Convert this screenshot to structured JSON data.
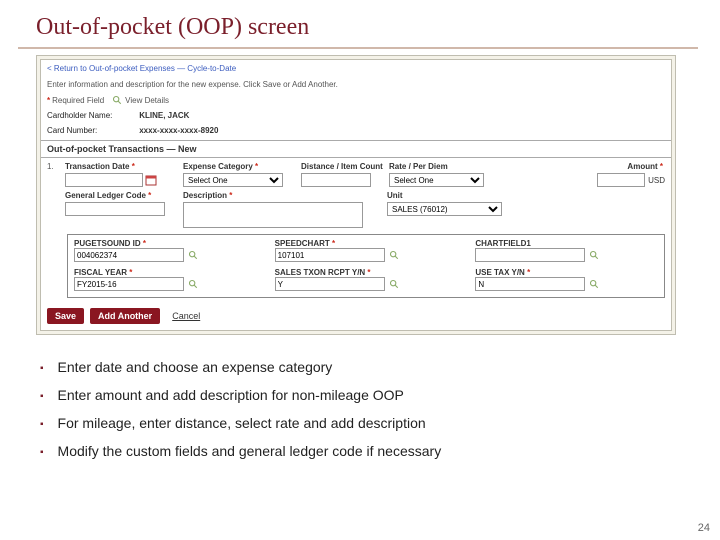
{
  "slide": {
    "title": "Out-of-pocket (OOP) screen",
    "page_number": "24"
  },
  "bullets": [
    "Enter date and choose an expense category",
    "Enter amount and add description for non-mileage OOP",
    "For mileage, enter distance, select rate and add description",
    "Modify the custom fields and general ledger code if necessary"
  ],
  "shot": {
    "back_link": "< Return to Out-of-pocket Expenses — Cycle-to-Date",
    "instruction": "Enter information and description for the new expense. Click Save or Add Another.",
    "required_field": "Required Field",
    "view_details": "View Details",
    "cardholder_label": "Cardholder Name:",
    "cardholder_value": "KLINE, JACK",
    "card_label": "Card Number:",
    "card_value": "xxxx-xxxx-xxxx-8920",
    "section_title": "Out-of-pocket Transactions — New",
    "row_number": "1.",
    "fields": {
      "transaction_date": "Transaction Date",
      "expense_category": "Expense Category",
      "expense_category_value": "Select One",
      "distance": "Distance / Item Count",
      "rate": "Rate / Per Diem",
      "rate_value": "Select One",
      "amount": "Amount",
      "amount_suffix": "USD",
      "gl_code": "General Ledger Code",
      "description": "Description",
      "unit": "Unit",
      "unit_value": "SALES (76012)"
    },
    "cf": {
      "pugetsound_id": {
        "label": "PUGETSOUND ID",
        "value": "004062374"
      },
      "speedchart": {
        "label": "SPEEDCHART",
        "value": "107101"
      },
      "chartfield1": {
        "label": "CHARTFIELD1",
        "value": ""
      },
      "fiscal_year": {
        "label": "FISCAL YEAR",
        "value": "FY2015-16"
      },
      "sales_txon": {
        "label": "SALES TXON RCPT Y/N",
        "value": "Y"
      },
      "use_tax": {
        "label": "USE TAX Y/N",
        "value": "N"
      }
    },
    "buttons": {
      "save": "Save",
      "add_another": "Add Another",
      "cancel": "Cancel"
    }
  }
}
